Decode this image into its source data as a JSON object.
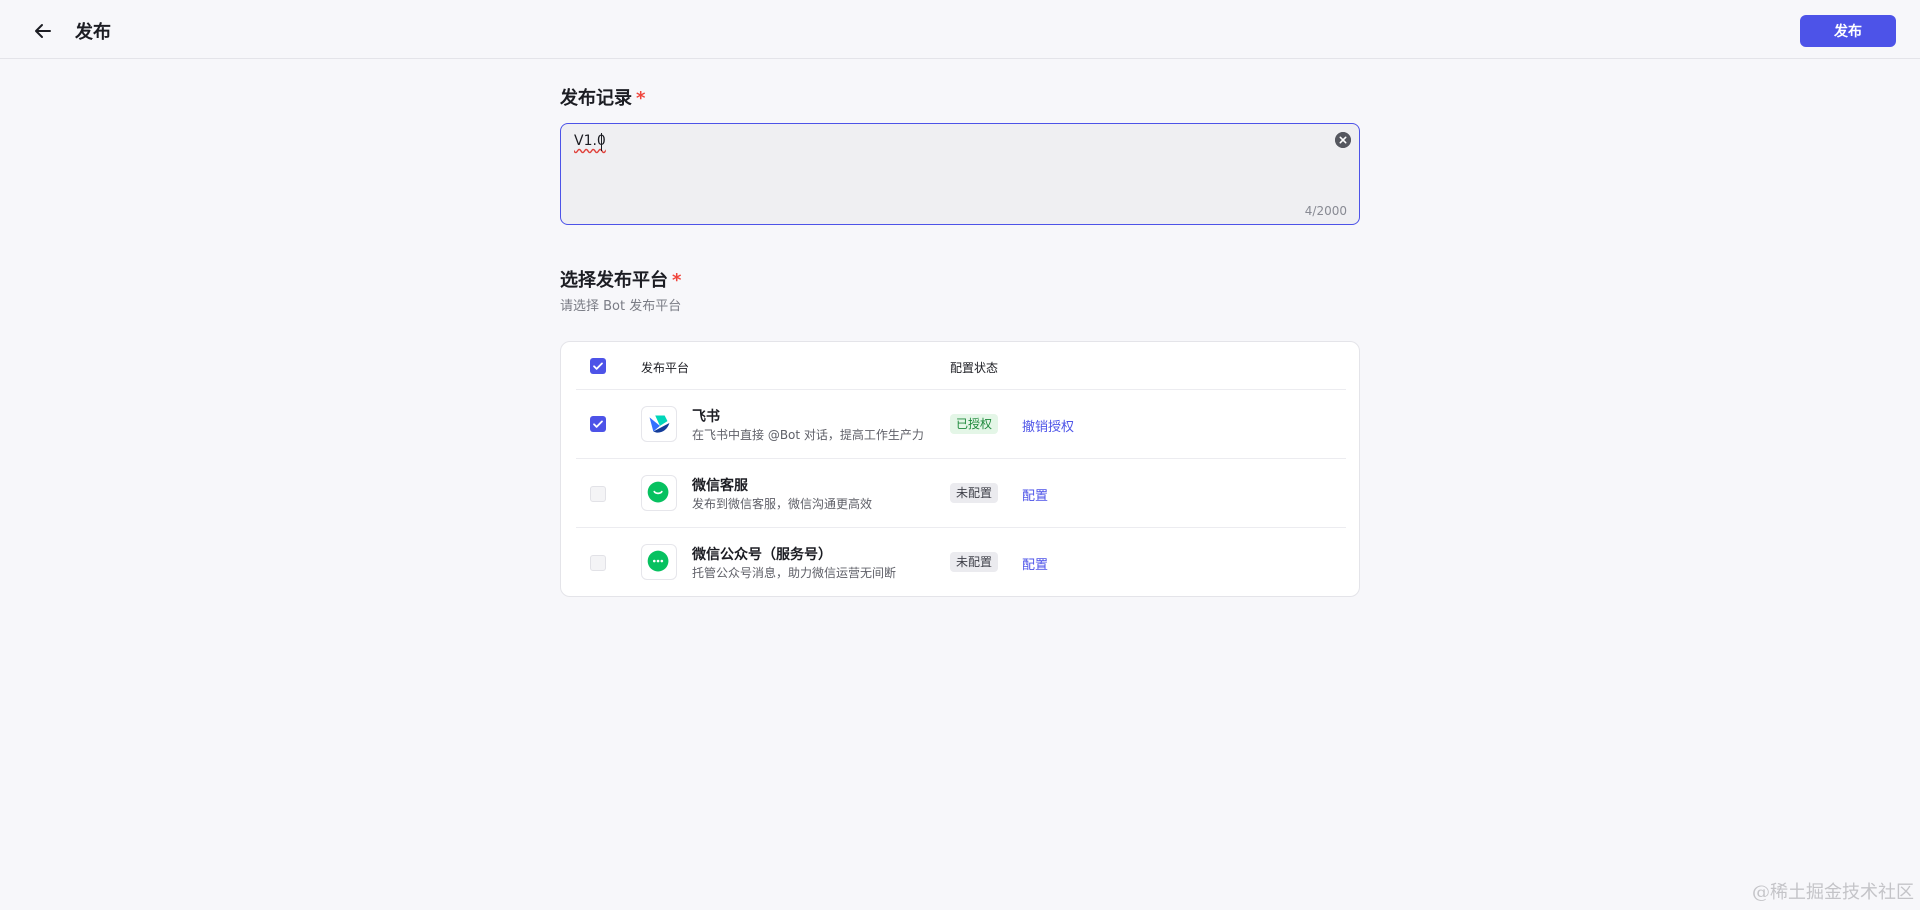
{
  "header": {
    "title": "发布",
    "publish_label": "发布"
  },
  "record": {
    "title": "发布记录",
    "required_mark": "*",
    "value": "V1.0",
    "counter": "4/2000"
  },
  "platform": {
    "title": "选择发布平台",
    "required_mark": "*",
    "subtitle": "请选择 Bot 发布平台",
    "columns": [
      "发布平台",
      "配置状态"
    ],
    "rows": [
      {
        "name": "飞书",
        "desc": "在飞书中直接 @Bot 对话，提高工作生产力",
        "status": "已授权",
        "action": "撤销授权",
        "checked": true
      },
      {
        "name": "微信客服",
        "desc": "发布到微信客服，微信沟通更高效",
        "status": "未配置",
        "action": "配置",
        "checked": false
      },
      {
        "name": "微信公众号（服务号）",
        "desc": "托管公众号消息，助力微信运营无间断",
        "status": "未配置",
        "action": "配置",
        "checked": false
      }
    ]
  },
  "watermark": "@稀土掘金技术社区",
  "colors": {
    "accent": "#4d53e8",
    "required": "#f0453c",
    "authorized_bg": "#e4f6e7",
    "authorized_text": "#1f8a3c"
  },
  "icons": {
    "back": "arrow-left-icon",
    "clear": "clear-icon",
    "feishu": "feishu-logo-icon",
    "wechat": "wechat-logo-icon"
  }
}
